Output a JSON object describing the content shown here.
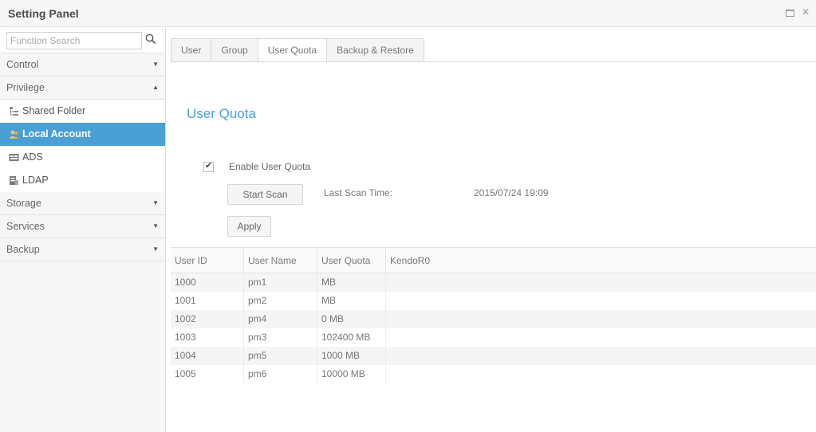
{
  "window": {
    "title": "Setting Panel"
  },
  "sidebar": {
    "search_placeholder": "Function Search",
    "sections": [
      {
        "label": "Control"
      },
      {
        "label": "Privilege"
      },
      {
        "label": "Storage"
      },
      {
        "label": "Services"
      },
      {
        "label": "Backup"
      }
    ],
    "privilege_items": [
      {
        "label": "Shared Folder"
      },
      {
        "label": "Local Account"
      },
      {
        "label": "ADS"
      },
      {
        "label": "LDAP"
      }
    ]
  },
  "tabs": [
    {
      "label": "User"
    },
    {
      "label": "Group"
    },
    {
      "label": "User Quota"
    },
    {
      "label": "Backup & Restore"
    }
  ],
  "quota": {
    "title": "User Quota",
    "enable_label": "Enable User Quota",
    "enabled": true,
    "start_scan_label": "Start Scan",
    "last_scan_label": "Last Scan Time:",
    "last_scan_value": "2015/07/24 19:09",
    "apply_label": "Apply"
  },
  "table": {
    "headers": [
      "User ID",
      "User Name",
      "User Quota",
      "KendoR0"
    ],
    "rows": [
      [
        "1000",
        "pm1",
        "MB",
        ""
      ],
      [
        "1001",
        "pm2",
        "MB",
        ""
      ],
      [
        "1002",
        "pm4",
        "0 MB",
        ""
      ],
      [
        "1003",
        "pm3",
        "102400 MB",
        ""
      ],
      [
        "1004",
        "pm5",
        "1000 MB",
        ""
      ],
      [
        "1005",
        "pm6",
        "10000 MB",
        ""
      ]
    ]
  },
  "colors": {
    "accent": "#4a9fd4",
    "active_item_bg": "#4a9fd4"
  },
  "icons": {
    "search": "search-icon",
    "shared_folder": "shared-folder-icon",
    "local_account": "local-account-icon",
    "ads": "ads-icon",
    "ldap": "ldap-icon",
    "expand": "chevron-down-icon",
    "collapse": "chevron-up-icon"
  }
}
